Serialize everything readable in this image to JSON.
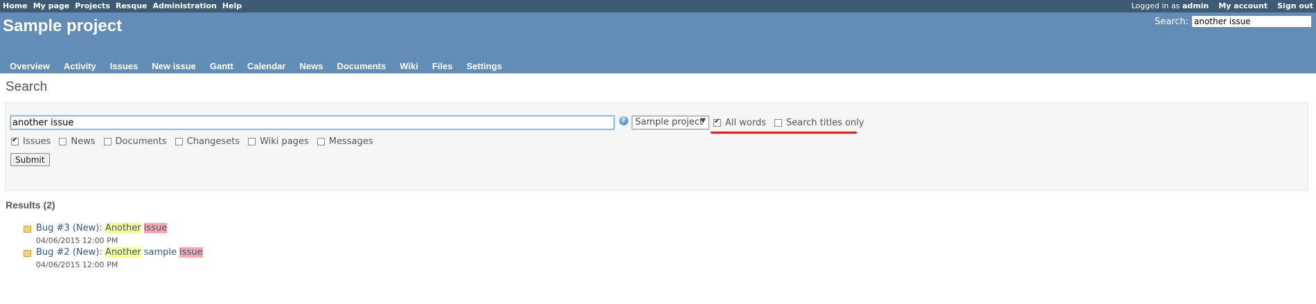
{
  "top_menu": {
    "left": [
      "Home",
      "My page",
      "Projects",
      "Resque",
      "Administration",
      "Help"
    ],
    "logged_prefix": "Logged in as",
    "logged_user": "admin",
    "my_account": "My account",
    "sign_out": "Sign out"
  },
  "header": {
    "project_title": "Sample project",
    "search_label": "Search:",
    "search_value": "another issue"
  },
  "main_menu": [
    "Overview",
    "Activity",
    "Issues",
    "New issue",
    "Gantt",
    "Calendar",
    "News",
    "Documents",
    "Wiki",
    "Files",
    "Settings"
  ],
  "search": {
    "title": "Search",
    "query": "another issue",
    "help_icon": "help-icon",
    "scope": "Sample project",
    "all_words_label": "All words",
    "all_words_checked": true,
    "titles_only_label": "Search titles only",
    "titles_only_checked": false,
    "types": [
      {
        "label": "Issues",
        "checked": true
      },
      {
        "label": "News",
        "checked": false
      },
      {
        "label": "Documents",
        "checked": false
      },
      {
        "label": "Changesets",
        "checked": false
      },
      {
        "label": "Wiki pages",
        "checked": false
      },
      {
        "label": "Messages",
        "checked": false
      }
    ],
    "submit_label": "Submit",
    "highlight_color": "#e31b1b"
  },
  "results": {
    "heading": "Results (2)",
    "items": [
      {
        "prefix": "Bug #3 (New): ",
        "parts": [
          {
            "text": "Another",
            "hl": 1
          },
          {
            "text": " ",
            "hl": 0
          },
          {
            "text": "issue",
            "hl": 2
          }
        ],
        "date": "04/06/2015 12:00 PM"
      },
      {
        "prefix": "Bug #2 (New): ",
        "parts": [
          {
            "text": "Another",
            "hl": 1
          },
          {
            "text": " sample ",
            "hl": 0
          },
          {
            "text": "issue",
            "hl": 2
          }
        ],
        "date": "04/06/2015 12:00 PM"
      }
    ]
  }
}
